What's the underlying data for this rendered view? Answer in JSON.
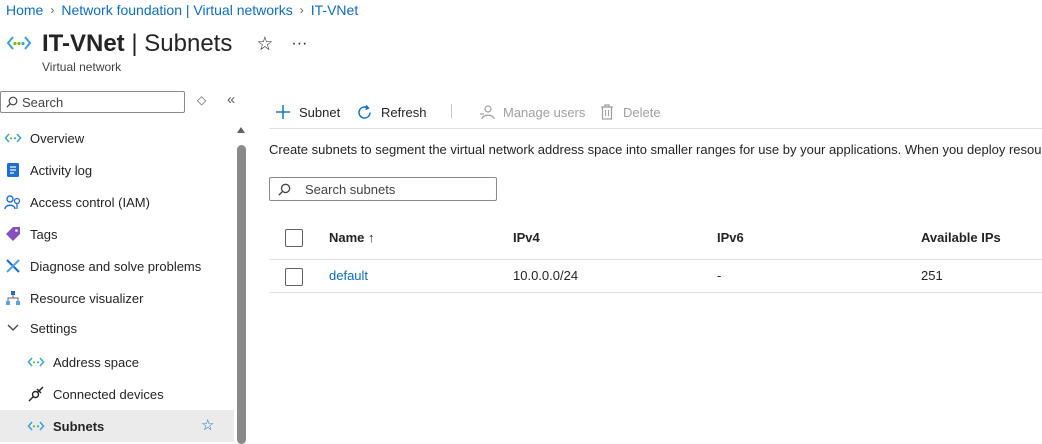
{
  "breadcrumb": [
    "Home",
    "Network foundation | Virtual networks",
    "IT-VNet"
  ],
  "title": {
    "name": "IT-VNet",
    "section": "Subnets",
    "subtitle": "Virtual network"
  },
  "sidebar": {
    "search_placeholder": "Search",
    "items": [
      {
        "label": "Overview",
        "icon": "vnet-icon"
      },
      {
        "label": "Activity log",
        "icon": "activity-log-icon"
      },
      {
        "label": "Access control (IAM)",
        "icon": "iam-icon"
      },
      {
        "label": "Tags",
        "icon": "tag-icon"
      },
      {
        "label": "Diagnose and solve problems",
        "icon": "wrench-icon"
      },
      {
        "label": "Resource visualizer",
        "icon": "hierarchy-icon"
      },
      {
        "label": "Settings",
        "icon": "chevron-down-icon"
      },
      {
        "label": "Address space",
        "icon": "vnet-icon"
      },
      {
        "label": "Connected devices",
        "icon": "plug-icon"
      },
      {
        "label": "Subnets",
        "icon": "vnet-icon",
        "selected": true
      }
    ]
  },
  "toolbar": {
    "add_subnet": "Subnet",
    "refresh": "Refresh",
    "manage_users": "Manage users",
    "delete": "Delete"
  },
  "description": "Create subnets to segment the virtual network address space into smaller ranges for use by your applications. When you deploy resou",
  "table": {
    "search_placeholder": "Search subnets",
    "columns": [
      "Name ↑",
      "IPv4",
      "IPv6",
      "Available IPs"
    ],
    "rows": [
      {
        "name": "default",
        "ipv4": "10.0.0.0/24",
        "ipv6": "-",
        "available_ips": "251"
      }
    ]
  },
  "colors": {
    "accent": "#0f6cbd",
    "vnet_teal": "#3aa0d8",
    "selected_bg": "#ebebeb"
  }
}
